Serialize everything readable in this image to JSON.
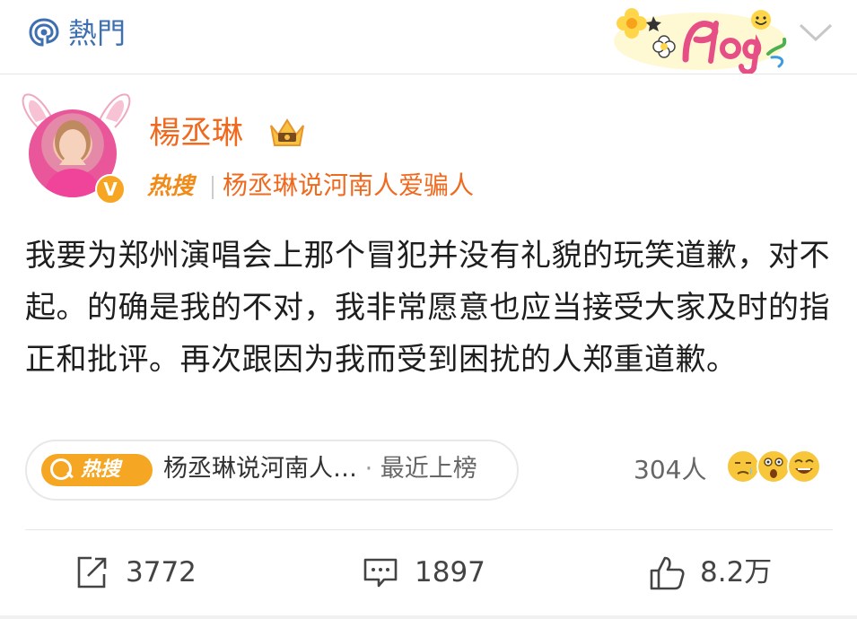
{
  "header": {
    "hot_label": "熱門"
  },
  "post": {
    "user_name": "楊丞琳",
    "hot_tag": "热搜",
    "hot_topic": "杨丞琳说河南人爱骗人",
    "text": "我要为郑州演唱会上那个冒犯并没有礼貌的玩笑道歉，对不起。的确是我的不对，我非常愿意也应当接受大家及时的指正和批评。再次跟因为我而受到困扰的人郑重道歉。",
    "trending_pill": {
      "icon_label": "热搜",
      "topic": "杨丞琳说河南人…",
      "separator": " · ",
      "rank_status": "最近上榜"
    },
    "reaction_count": "304人",
    "actions": {
      "repost_count": "3772",
      "comment_count": "1897",
      "like_count": "8.2万"
    }
  },
  "colors": {
    "name_orange": "#ef6a1f",
    "hot_blue": "#3e6fb0",
    "tag_orange": "#f5a623"
  }
}
